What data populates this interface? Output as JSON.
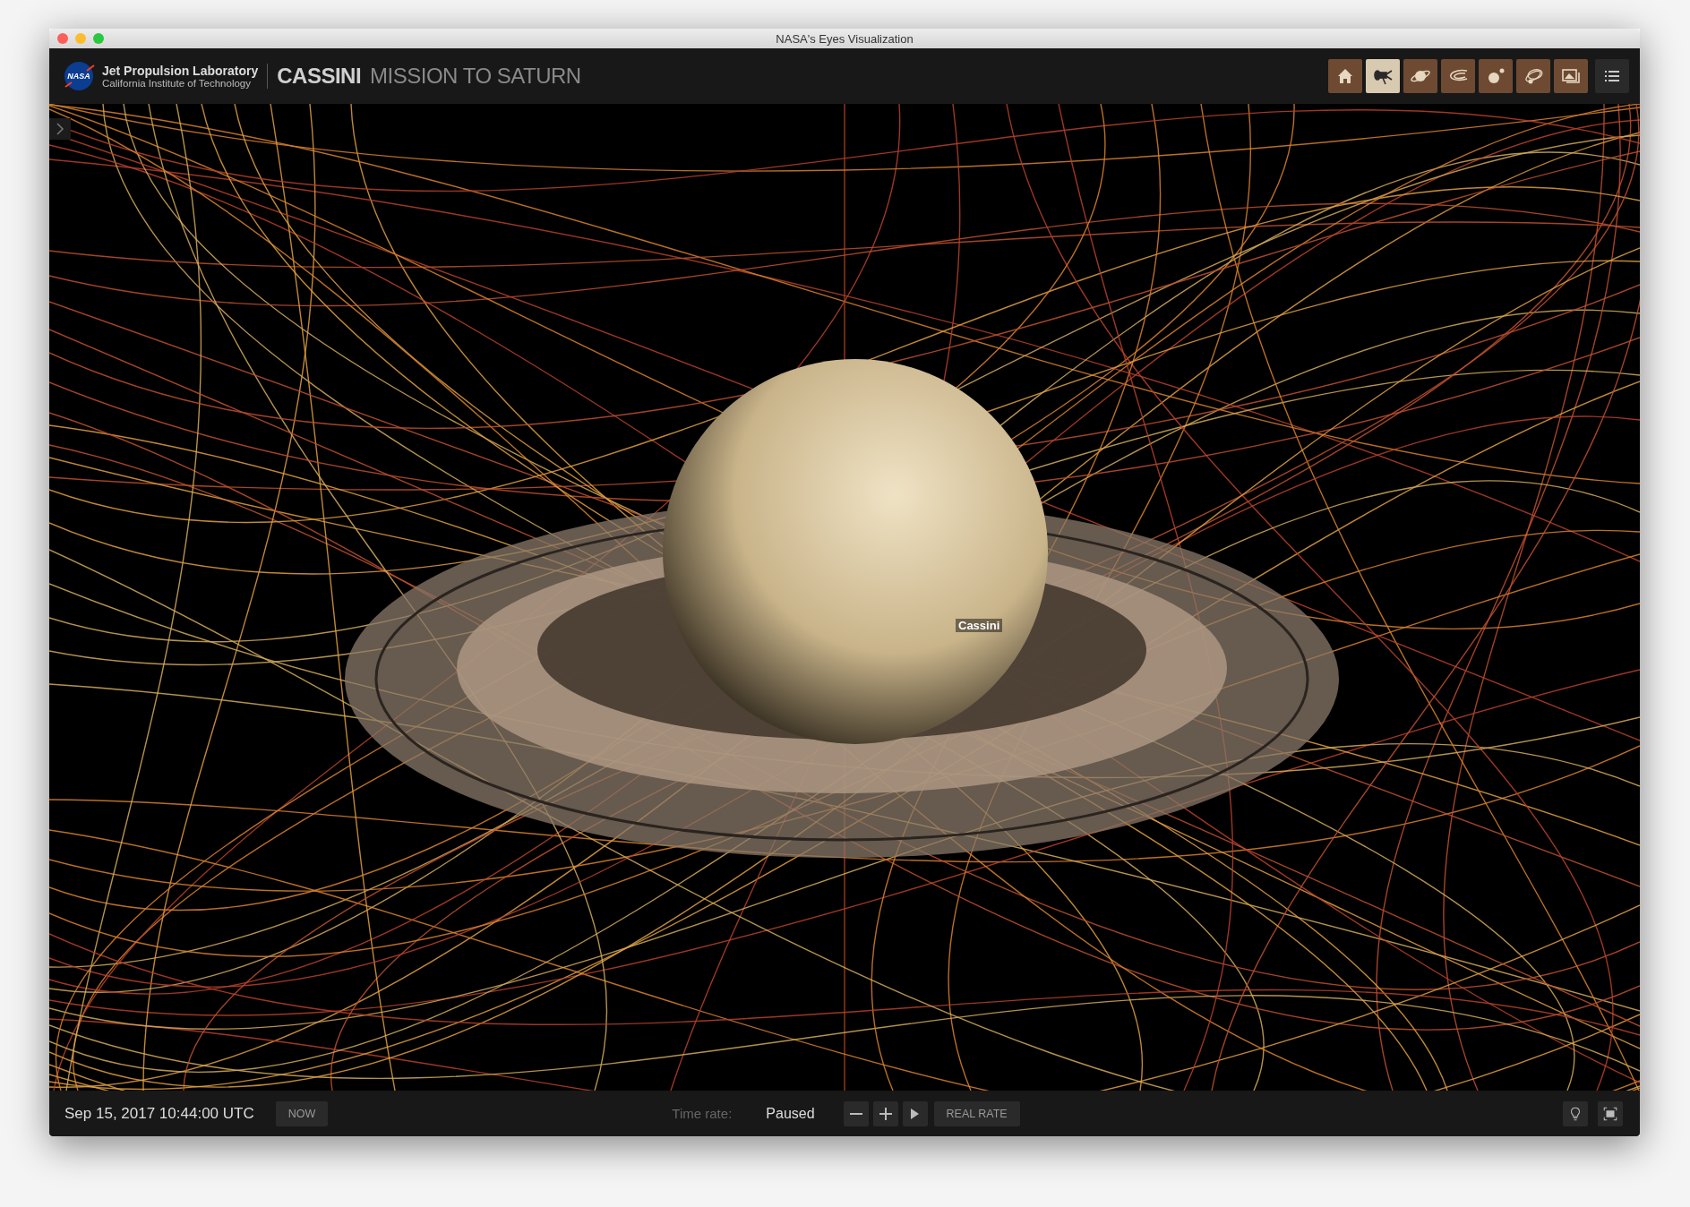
{
  "window": {
    "title": "NASA's Eyes Visualization"
  },
  "header": {
    "logo_text": "NASA",
    "org_name": "Jet Propulsion Laboratory",
    "org_subtitle": "California Institute of Technology",
    "mission": "CASSINI",
    "mission_subtitle": "MISSION TO SATURN"
  },
  "toolbar": [
    {
      "kind": "home",
      "selected": false
    },
    {
      "kind": "spacecraft",
      "selected": true
    },
    {
      "kind": "planet",
      "selected": false
    },
    {
      "kind": "rings",
      "selected": false
    },
    {
      "kind": "moons",
      "selected": false
    },
    {
      "kind": "orbits",
      "selected": false
    },
    {
      "kind": "gallery",
      "selected": false
    }
  ],
  "scene": {
    "spacecraft_label": "Cassini"
  },
  "footer": {
    "date": "Sep 15, 2017 10:44:00 UTC",
    "now_button": "NOW",
    "time_rate_label": "Time rate:",
    "time_rate": "Paused",
    "rate_buttons": [
      {
        "kind": "minus"
      },
      {
        "kind": "plus"
      },
      {
        "kind": "play"
      }
    ],
    "real_rate_button": "REAL RATE"
  }
}
